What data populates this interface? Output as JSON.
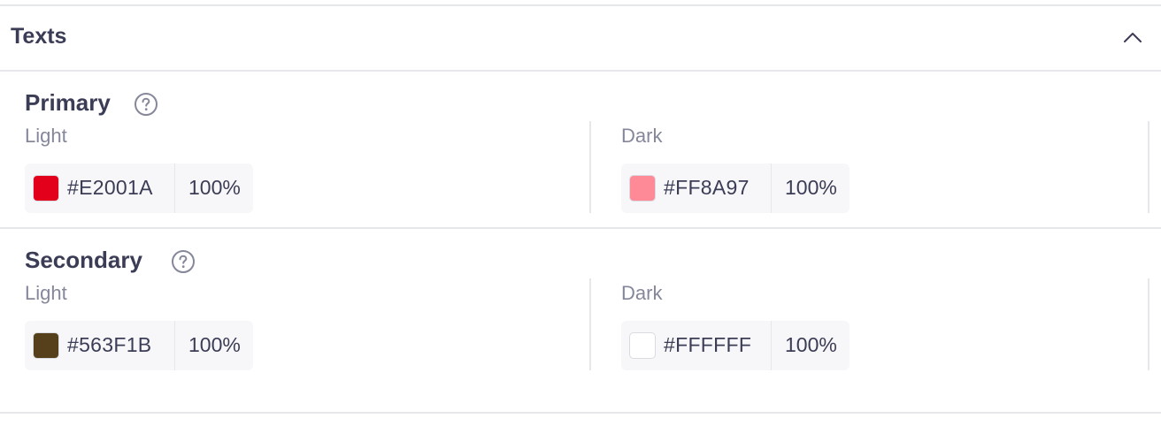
{
  "panel": {
    "title": "Texts",
    "collapse_icon": "chevron-up-icon"
  },
  "sections": [
    {
      "title": "Primary",
      "help_icon": "question-circle-icon",
      "light": {
        "label": "Light",
        "hex": "#E2001A",
        "opacity": "100%",
        "swatch": "#E2001A"
      },
      "dark": {
        "label": "Dark",
        "hex": "#FF8A97",
        "opacity": "100%",
        "swatch": "#FF8A97"
      }
    },
    {
      "title": "Secondary",
      "help_icon": "question-circle-icon",
      "light": {
        "label": "Light",
        "hex": "#563F1B",
        "opacity": "100%",
        "swatch": "#563F1B"
      },
      "dark": {
        "label": "Dark",
        "hex": "#FFFFFF",
        "opacity": "100%",
        "swatch": "#FFFFFF"
      }
    }
  ],
  "colors": {
    "text": "#3B3C55",
    "muted": "#85879A",
    "border": "#E6E7EA",
    "chip_bg": "#F7F7F9"
  }
}
